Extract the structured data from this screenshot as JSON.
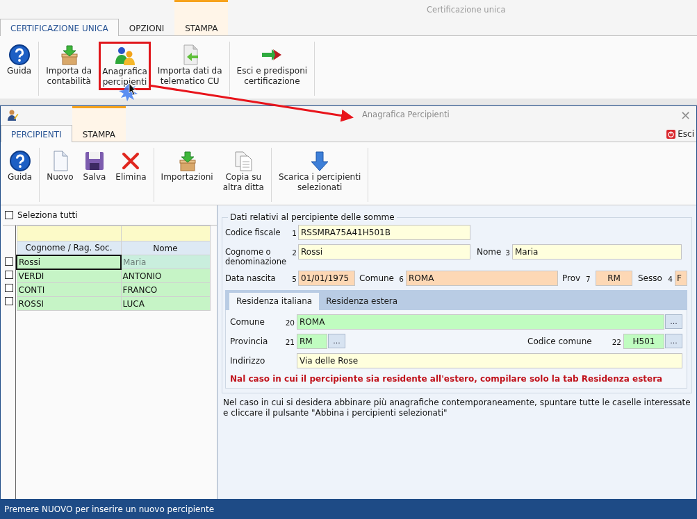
{
  "app": {
    "title": "Certificazione unica",
    "tabs": [
      {
        "label": "CERTIFICAZIONE UNICA",
        "selected": true,
        "accent": false
      },
      {
        "label": "OPZIONI",
        "selected": false,
        "accent": false
      },
      {
        "label": "STAMPA",
        "selected": false,
        "accent": true
      }
    ],
    "ribbon": [
      [
        {
          "label": "Guida",
          "kind": "help",
          "highlighted": false
        }
      ],
      [
        {
          "label": "Importa da\ncontabilità",
          "kind": "import-box",
          "highlighted": false
        },
        {
          "label": "Anagrafica\npercipienti",
          "kind": "people",
          "highlighted": true
        },
        {
          "label": "Importa dati da\ntelematico CU",
          "kind": "doc-import",
          "highlighted": false
        }
      ],
      [
        {
          "label": "Esci e predisponi\ncertificazione",
          "kind": "exit-arrow",
          "highlighted": false
        }
      ]
    ]
  },
  "window": {
    "title": "Anagrafica Percipienti",
    "close": "×",
    "exit": "Esci",
    "tabs": [
      {
        "label": "PERCIPIENTI",
        "selected": true,
        "accent": false
      },
      {
        "label": "STAMPA",
        "selected": false,
        "accent": true
      }
    ],
    "ribbon": [
      [
        {
          "label": "Guida",
          "kind": "help",
          "highlighted": false
        }
      ],
      [
        {
          "label": "Nuovo",
          "kind": "new-doc",
          "highlighted": false
        },
        {
          "label": "Salva",
          "kind": "save",
          "highlighted": false
        },
        {
          "label": "Elimina",
          "kind": "delete",
          "highlighted": false
        }
      ],
      [
        {
          "label": "Importazioni",
          "kind": "import-box",
          "highlighted": false
        },
        {
          "label": "Copia su\naltra ditta",
          "kind": "copy",
          "highlighted": false
        }
      ],
      [
        {
          "label": "Scarica i percipienti\nselezionati",
          "kind": "down-arrow",
          "highlighted": false
        }
      ]
    ]
  },
  "list": {
    "select_all": {
      "label": "Seleziona tutti",
      "checked": false
    },
    "columns": [
      "Cognome / Rag. Soc.",
      "Nome"
    ],
    "rows": [
      {
        "cells": [
          "Rossi",
          "Maria"
        ],
        "checked": false,
        "selected": true
      },
      {
        "cells": [
          "VERDI",
          "ANTONIO"
        ],
        "checked": false,
        "selected": false
      },
      {
        "cells": [
          "CONTI",
          "FRANCO"
        ],
        "checked": false,
        "selected": false
      },
      {
        "cells": [
          "ROSSI",
          "LUCA"
        ],
        "checked": false,
        "selected": false
      }
    ]
  },
  "form": {
    "legend": "Dati relativi al percipiente delle somme",
    "rows": [
      [
        {
          "label": "Codice fiscale",
          "number": "1",
          "value": "RSSMRA75A41H501B",
          "color": "#ffffdd"
        }
      ],
      [
        {
          "label": "Cognome o\ndenominazione",
          "number": "2",
          "value": "Rossi",
          "color": "#ffffdd"
        },
        {
          "label": "Nome",
          "number": "3",
          "value": "Maria",
          "color": "#ffffdd"
        }
      ],
      [
        {
          "label": "Data nascita",
          "number": "5",
          "value": "01/01/1975",
          "color": "#fdd8b5"
        },
        {
          "label": "Comune",
          "number": "6",
          "value": "ROMA",
          "color": "#fdd8b5"
        },
        {
          "label": "Prov",
          "number": "7",
          "value": "RM",
          "color": "#fdd8b5"
        },
        {
          "label": "Sesso",
          "number": "4",
          "value": "F",
          "color": "#fdd8b5"
        }
      ]
    ],
    "residence": {
      "tabs": [
        {
          "label": "Residenza italiana",
          "selected": true
        },
        {
          "label": "Residenza estera",
          "selected": false
        }
      ],
      "rows": [
        [
          {
            "label": "Comune",
            "number": "20",
            "value": "ROMA",
            "color": "#c0fcc0",
            "browse": "..."
          }
        ],
        [
          {
            "label": "Provincia",
            "number": "21",
            "value": "RM",
            "color": "#c0fcc0",
            "browse": "..."
          },
          {
            "label": "Codice comune",
            "number": "22",
            "value": "H501",
            "color": "#c0fcc0",
            "browse": "..."
          }
        ],
        [
          {
            "label": "Indirizzo",
            "value": "Via delle Rose",
            "color": "#ffffdd"
          }
        ]
      ],
      "warning": "Nal caso in cui il percipiente sia residente all'estero, compilare solo la tab Residenza estera"
    },
    "note": "Nel caso in cui si desidera abbinare più anagrafiche contemporaneamente, spuntare tutte le caselle interessate e cliccare il pulsante \"Abbina i percipienti selezionati\""
  },
  "status_bar": "Premere NUOVO per inserire un nuovo percipiente"
}
